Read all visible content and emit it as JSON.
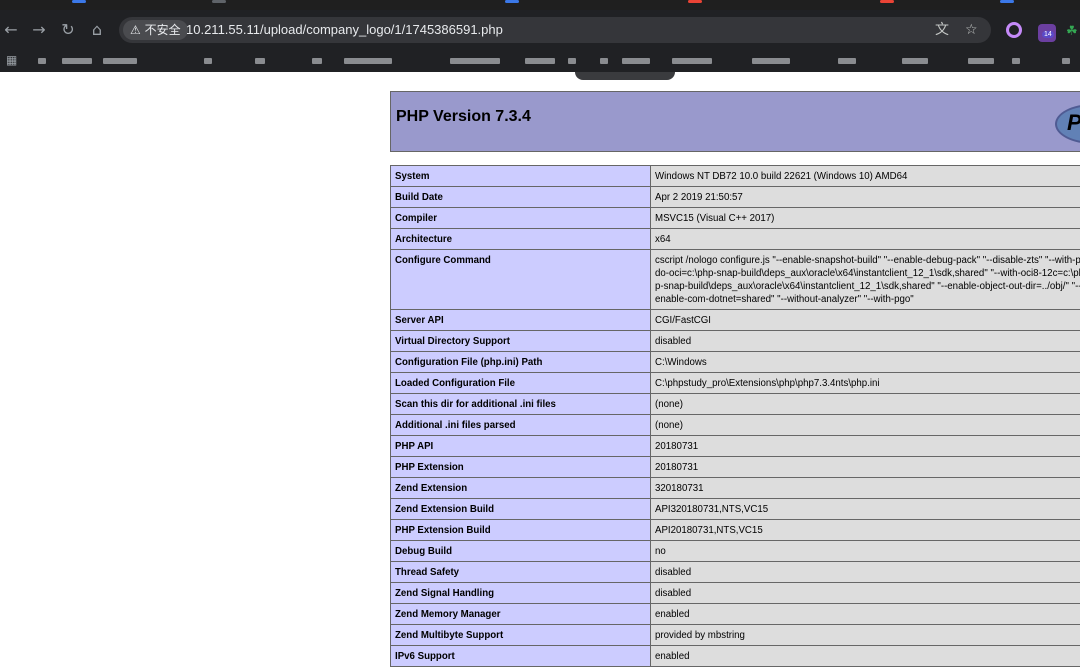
{
  "browser": {
    "security_label": "不安全",
    "url": "10.211.55.11/upload/company_logo/1/1745386591.php",
    "nav_icons": [
      "back-icon",
      "forward-icon",
      "reload-icon",
      "home-icon"
    ],
    "omnibox_icons": [
      "translate-icon",
      "bookmark-star-icon"
    ],
    "extension_badge": "14",
    "accent_color": "#c58af9"
  },
  "php": {
    "version_title": "PHP Version 7.3.4",
    "logo_text": "P",
    "header_color": "#9999cc",
    "key_color": "#ccccff",
    "value_color": "#dddddd",
    "rows": [
      {
        "key": "System",
        "value": "Windows NT DB72 10.0 build 22621 (Windows 10) AMD64"
      },
      {
        "key": "Build Date",
        "value": "Apr 2 2019 21:50:57"
      },
      {
        "key": "Compiler",
        "value": "MSVC15 (Visual C++ 2017)"
      },
      {
        "key": "Architecture",
        "value": "x64"
      },
      {
        "key": "Configure Command",
        "value": "cscript /nologo configure.js \"--enable-snapshot-build\" \"--enable-debug-pack\" \"--disable-zts\" \"--with-pdo-oci=c:\\php-snap-build\\deps_aux\\oracle\\x64\\instantclient_12_1\\sdk,shared\" \"--with-oci8-12c=c:\\php-snap-build\\deps_aux\\oracle\\x64\\instantclient_12_1\\sdk,shared\" \"--enable-object-out-dir=../obj/\" \"--enable-com-dotnet=shared\" \"--without-analyzer\" \"--with-pgo\""
      },
      {
        "key": "Server API",
        "value": "CGI/FastCGI"
      },
      {
        "key": "Virtual Directory Support",
        "value": "disabled"
      },
      {
        "key": "Configuration File (php.ini) Path",
        "value": "C:\\Windows"
      },
      {
        "key": "Loaded Configuration File",
        "value": "C:\\phpstudy_pro\\Extensions\\php\\php7.3.4nts\\php.ini"
      },
      {
        "key": "Scan this dir for additional .ini files",
        "value": "(none)"
      },
      {
        "key": "Additional .ini files parsed",
        "value": "(none)"
      },
      {
        "key": "PHP API",
        "value": "20180731"
      },
      {
        "key": "PHP Extension",
        "value": "20180731"
      },
      {
        "key": "Zend Extension",
        "value": "320180731"
      },
      {
        "key": "Zend Extension Build",
        "value": "API320180731,NTS,VC15"
      },
      {
        "key": "PHP Extension Build",
        "value": "API20180731,NTS,VC15"
      },
      {
        "key": "Debug Build",
        "value": "no"
      },
      {
        "key": "Thread Safety",
        "value": "disabled"
      },
      {
        "key": "Zend Signal Handling",
        "value": "disabled"
      },
      {
        "key": "Zend Memory Manager",
        "value": "enabled"
      },
      {
        "key": "Zend Multibyte Support",
        "value": "provided by mbstring"
      },
      {
        "key": "IPv6 Support",
        "value": "enabled"
      }
    ]
  }
}
